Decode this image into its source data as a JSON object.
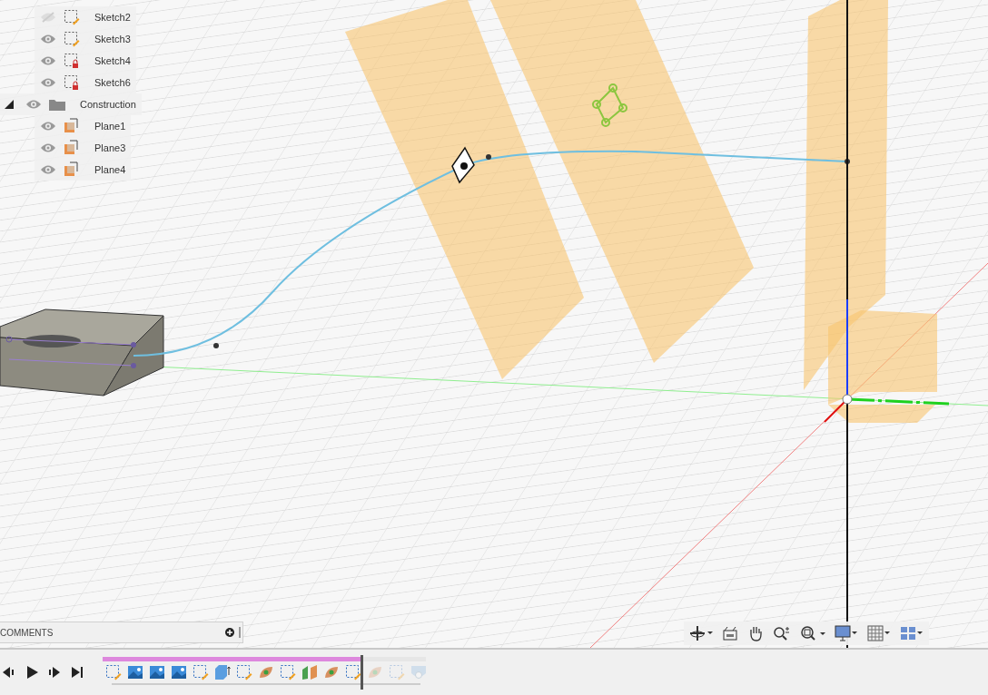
{
  "browser": {
    "items": [
      {
        "label": "Sketch2",
        "kind": "sketch",
        "visible": false
      },
      {
        "label": "Sketch3",
        "kind": "sketch",
        "visible": true
      },
      {
        "label": "Sketch4",
        "kind": "sketch-locked",
        "visible": true
      },
      {
        "label": "Sketch6",
        "kind": "sketch-locked",
        "visible": true
      },
      {
        "label": "Construction",
        "kind": "folder",
        "visible": true,
        "expanded": true,
        "children": [
          {
            "label": "Plane1",
            "kind": "plane",
            "visible": true
          },
          {
            "label": "Plane3",
            "kind": "plane",
            "visible": true
          },
          {
            "label": "Plane4",
            "kind": "plane",
            "visible": true
          }
        ]
      }
    ]
  },
  "comments": {
    "label": "COMMENTS"
  },
  "timeline": {
    "level": 0.8,
    "features": [
      {
        "kind": "sketch",
        "rolled_back": false
      },
      {
        "kind": "canvas",
        "rolled_back": false
      },
      {
        "kind": "canvas",
        "rolled_back": false
      },
      {
        "kind": "canvas",
        "rolled_back": false
      },
      {
        "kind": "sketch",
        "rolled_back": false
      },
      {
        "kind": "extrude",
        "rolled_back": false
      },
      {
        "kind": "sketch",
        "rolled_back": false
      },
      {
        "kind": "sweep",
        "rolled_back": false
      },
      {
        "kind": "sketch",
        "rolled_back": false
      },
      {
        "kind": "split",
        "rolled_back": false
      },
      {
        "kind": "sweep",
        "rolled_back": false
      },
      {
        "kind": "sketch",
        "rolled_back": false
      },
      {
        "kind": "sweep",
        "rolled_back": true
      },
      {
        "kind": "sketch",
        "rolled_back": true
      },
      {
        "kind": "shell",
        "rolled_back": true
      }
    ]
  }
}
